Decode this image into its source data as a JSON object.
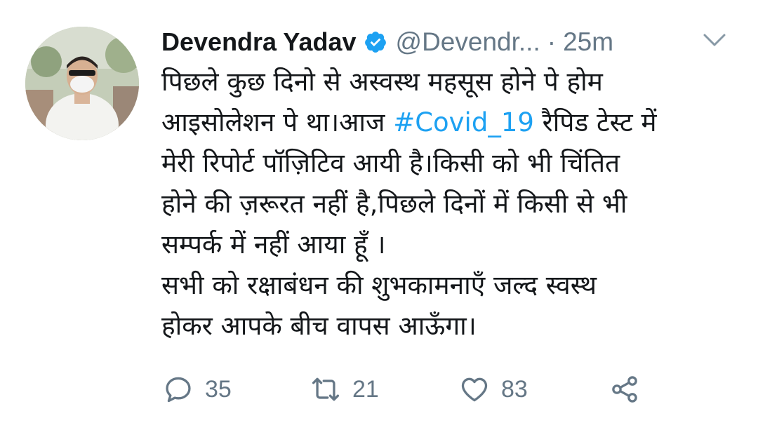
{
  "author": {
    "name": "Devendra Yadav",
    "handle": "@Devendr...",
    "separator": "·",
    "time": "25m",
    "verified": true
  },
  "tweet": {
    "lines": [
      "पिछले कुछ दिनो से अस्वस्थ महसूस होने पे होम",
      "आइसोलेशन पे था।आज",
      "मेरी रिपोर्ट पॉज़िटिव आयी है।किसी को भी चिंतित",
      "होने की ज़रूरत नहीं है,पिछले दिनों में किसी से भी",
      "सम्पर्क में नहीं आया हूँ ।",
      "सभी को रक्षाबंधन की शुभकामनाएँ जल्द स्वस्थ",
      "होकर आपके बीच वापस आऊँगा।"
    ],
    "hashtag": "#Covid_19",
    "line2_after": "रैपिड टेस्ट में"
  },
  "actions": {
    "replies": "35",
    "retweets": "21",
    "likes": "83"
  },
  "colors": {
    "link": "#1da1f2",
    "secondary_text": "#657786",
    "primary_text": "#14171a"
  },
  "icons": [
    "verified-badge-icon",
    "chevron-down-icon",
    "reply-icon",
    "retweet-icon",
    "like-icon",
    "share-icon"
  ]
}
